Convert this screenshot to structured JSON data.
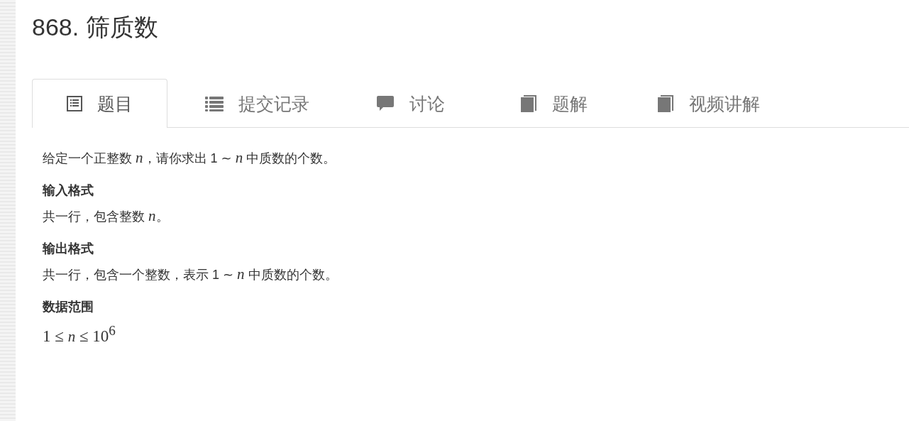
{
  "title": "868. 筛质数",
  "tabs": [
    {
      "label": "题目",
      "kind": "document",
      "selected": true
    },
    {
      "label": "提交记录",
      "kind": "list",
      "selected": false
    },
    {
      "label": "讨论",
      "kind": "comment",
      "selected": false
    },
    {
      "label": "题解",
      "kind": "book",
      "selected": false
    },
    {
      "label": "视频讲解",
      "kind": "book",
      "selected": false
    }
  ],
  "content": [
    {
      "kind": "paragraph",
      "text": "给定一个正整数 *n*，请你求出 1 ∼ *n* 中质数的个数。"
    },
    {
      "kind": "heading",
      "text": "输入格式"
    },
    {
      "kind": "paragraph",
      "text": "共一行，包含整数 *n*。"
    },
    {
      "kind": "heading",
      "text": "输出格式"
    },
    {
      "kind": "paragraph",
      "text": "共一行，包含一个整数，表示 1 ∼ *n* 中质数的个数。"
    },
    {
      "kind": "heading",
      "text": "数据范围"
    },
    {
      "kind": "formula",
      "text": "1 ≤ *n* ≤ 10$^{6}$"
    }
  ]
}
